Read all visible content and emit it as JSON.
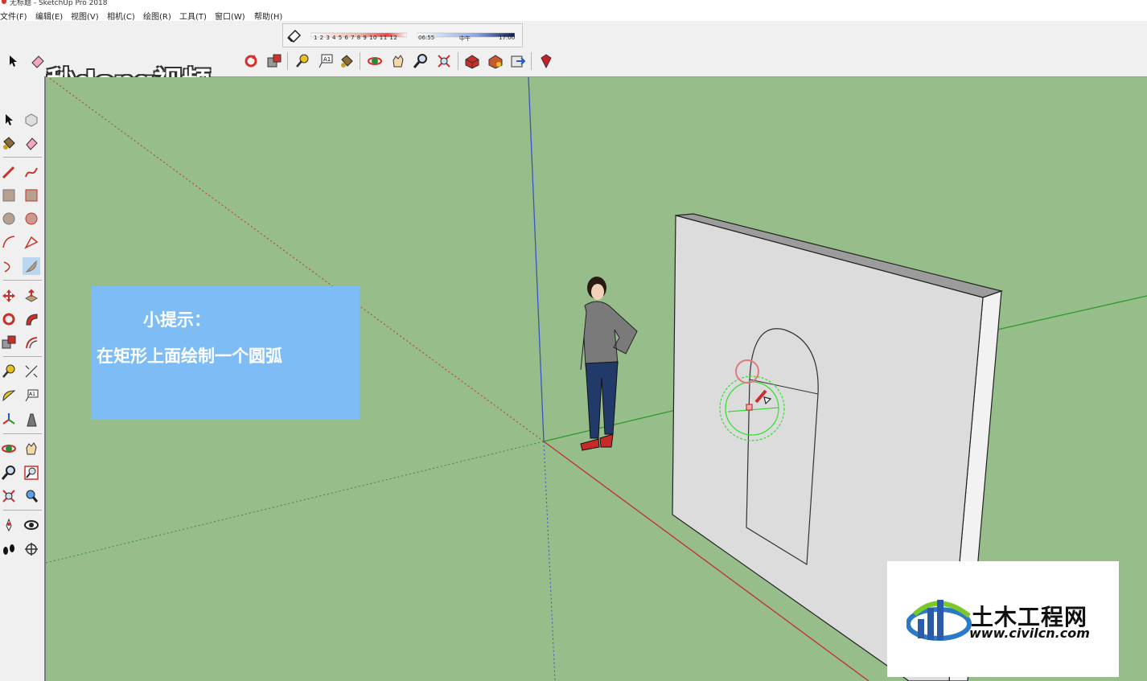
{
  "window": {
    "title": "无标题 - SketchUp Pro 2018"
  },
  "menu": [
    "文件(F)",
    "编辑(E)",
    "视图(V)",
    "相机(C)",
    "绘图(R)",
    "工具(T)",
    "窗口(W)",
    "帮助(H)"
  ],
  "shadows": {
    "month_ticks": "1 2 3 4 5 6 7 8 9 10 11 12",
    "time_start": "06:55",
    "time_mid": "中午",
    "time_end": "17:00"
  },
  "watermark": "秒dong视频",
  "tip": {
    "title": "小提示：",
    "body": "在矩形上面绘制一个圆弧"
  },
  "logo": {
    "name": "土木工程网",
    "url": "www.civilcn.com"
  },
  "colors": {
    "viewport_bg": "#96bd8a",
    "tip_bg": "#7ebcf5",
    "axis_red": "#c0302a",
    "axis_green": "#2e9a2e",
    "axis_blue": "#3a55c8"
  },
  "icons": {
    "top_toolbar": [
      "select-icon",
      "eraser-icon",
      "rotate-icon",
      "scale-icon",
      "tape-measure-icon",
      "text-icon",
      "paint-bucket-icon",
      "orbit-icon",
      "pan-icon",
      "zoom-icon",
      "zoom-extents-icon",
      "warehouse-icon",
      "extension-icon",
      "share-icon",
      "ruby-icon"
    ],
    "left_toolbar": [
      "select-icon",
      "make-component-icon",
      "paint-bucket-icon",
      "eraser-icon",
      "line-icon",
      "freehand-icon",
      "rectangle-icon",
      "rotated-rectangle-icon",
      "circle-icon",
      "polygon-icon",
      "arc-icon",
      "two-point-arc-icon",
      "three-point-arc-icon",
      "pie-icon",
      "move-icon",
      "push-pull-icon",
      "rotate-icon",
      "follow-me-icon",
      "scale-icon",
      "offset-icon",
      "tape-measure-icon",
      "dimension-icon",
      "protractor-icon",
      "text-icon",
      "axes-icon",
      "3d-text-icon",
      "orbit-icon",
      "pan-icon",
      "zoom-icon",
      "zoom-window-icon",
      "zoom-extents-icon",
      "previous-view-icon",
      "position-camera-icon",
      "look-around-icon",
      "walk-icon",
      "section-plane-icon"
    ]
  }
}
